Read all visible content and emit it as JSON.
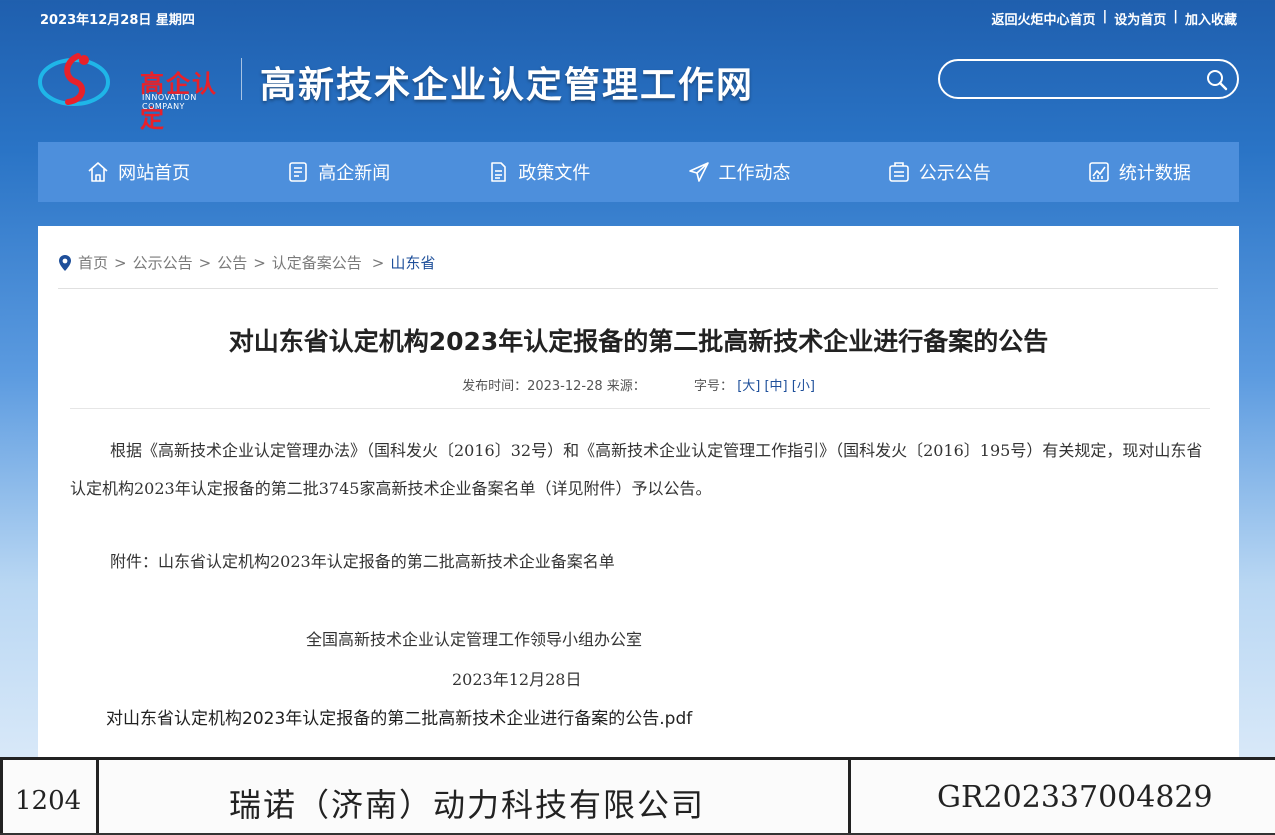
{
  "topbar": {
    "date": "2023年12月28日 星期四",
    "links": [
      "返回火炬中心首页",
      "设为首页",
      "加入收藏"
    ],
    "separator": "|"
  },
  "header": {
    "logo_text": "高企认定",
    "logo_sub": "INNOVATION COMPANY",
    "site_title": "高新技术企业认定管理工作网",
    "search_placeholder": ""
  },
  "nav": {
    "items": [
      {
        "label": "网站首页",
        "icon": "home-icon"
      },
      {
        "label": "高企新闻",
        "icon": "news-icon"
      },
      {
        "label": "政策文件",
        "icon": "document-icon"
      },
      {
        "label": "工作动态",
        "icon": "send-icon"
      },
      {
        "label": "公示公告",
        "icon": "notice-icon"
      },
      {
        "label": "统计数据",
        "icon": "chart-icon"
      }
    ]
  },
  "breadcrumb": {
    "items": [
      "首页",
      "公示公告",
      "公告",
      "认定备案公告"
    ],
    "current": "山东省",
    "separator": ">"
  },
  "article": {
    "title": "对山东省认定机构2023年认定报备的第二批高新技术企业进行备案的公告",
    "meta_publish": "发布时间：2023-12-28 来源：",
    "meta_fontsize_label": "字号：",
    "font_sizes": [
      "[大]",
      "[中]",
      "[小]"
    ],
    "body": "根据《高新技术企业认定管理办法》（国科发火〔2016〕32号）和《高新技术企业认定管理工作指引》（国科发火〔2016〕195号）有关规定，现对山东省认定机构2023年认定报备的第二批3745家高新技术企业备案名单（详见附件）予以公告。",
    "attachment_note": "附件：山东省认定机构2023年认定报备的第二批高新技术企业备案名单",
    "sign_org": "全国高新技术企业认定管理工作领导小组办公室",
    "sign_date": "2023年12月28日",
    "pdf_link": "对山东省认定机构2023年认定报备的第二批高新技术企业进行备案的公告.pdf"
  },
  "scan_row": {
    "number": "1204",
    "company": "瑞诺（济南）动力科技有限公司",
    "code": "GR202337004829"
  },
  "colors": {
    "nav_bg": "#4d8fdc",
    "logo_red": "#e8212a",
    "link_blue": "#1e4f9a"
  }
}
